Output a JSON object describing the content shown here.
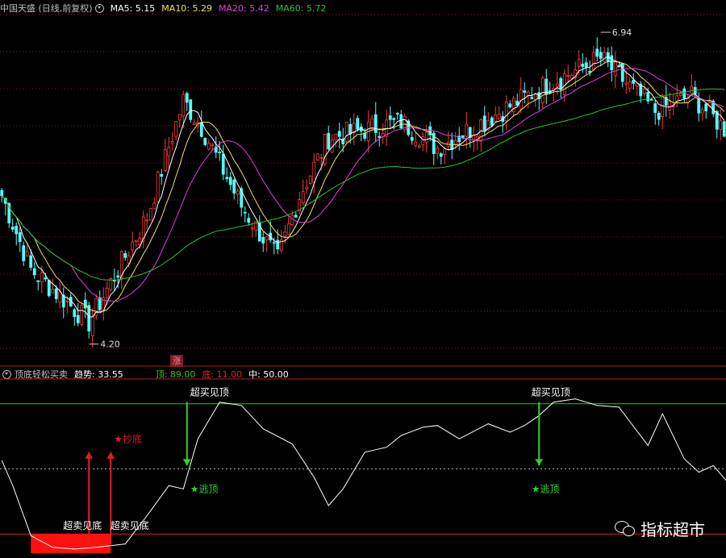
{
  "main_header": {
    "title": "中国天盛 (日线,前复权)",
    "ma5": "MA5: 5.15",
    "ma10": "MA10: 5.29",
    "ma20": "MA20: 5.42",
    "ma60": "MA60: 5.72"
  },
  "sub_header": {
    "title": "顶底轻松买卖",
    "trend": "趋势: 33.55",
    "top": "顶: 89.00",
    "bottom": "底: 11.00",
    "mid": "中: 50.00"
  },
  "badge": "涨",
  "watermark": "指标超市",
  "colors": {
    "up": "#ff3b3b",
    "down": "#54ffff",
    "ma5": "#ffffff",
    "ma10": "#f0e060",
    "ma20": "#e040e0",
    "ma60": "#30c030",
    "grid": "#8a1e1e",
    "top_line": "#30c030",
    "bottom_line": "#e02020",
    "mid_line": "#b0b0b0",
    "trend_line": "#ffffff"
  },
  "chart_data": [
    {
      "type": "candlestick",
      "title": "中国天盛 (日线,前复权)",
      "ylim": [
        3.9,
        7.2
      ],
      "annotations": [
        {
          "label": "4.20",
          "x": 24,
          "y": 4.2
        },
        {
          "label": "6.94",
          "x": 165,
          "y": 6.94
        }
      ],
      "key_points": {
        "x": [
          0,
          8,
          24,
          40,
          50,
          55,
          66,
          76,
          82,
          90,
          110,
          120,
          150,
          165,
          180,
          190,
          200
        ],
        "close": [
          5.5,
          4.8,
          4.3,
          5.3,
          6.4,
          6.15,
          5.4,
          4.9,
          5.5,
          6.05,
          6.2,
          5.95,
          6.55,
          6.8,
          6.3,
          6.45,
          6.1
        ]
      },
      "series": [
        {
          "name": "MA5",
          "value": 5.15
        },
        {
          "name": "MA10",
          "value": 5.29
        },
        {
          "name": "MA20",
          "value": 5.42
        },
        {
          "name": "MA60",
          "value": 5.72
        }
      ]
    },
    {
      "type": "line",
      "title": "顶底轻松买卖",
      "ylim": [
        0,
        100
      ],
      "levels": {
        "top": 89.0,
        "bottom": 11.0,
        "mid": 50.0
      },
      "trend_now": 33.55,
      "trend": {
        "x": [
          0,
          3,
          8,
          14,
          20,
          26,
          34,
          40,
          46,
          50,
          54,
          60,
          66,
          72,
          80,
          86,
          90,
          94,
          100,
          106,
          110,
          116,
          120,
          126,
          134,
          140,
          144,
          148,
          152,
          158,
          164,
          170,
          178,
          182,
          188,
          192,
          196,
          200
        ],
        "y": [
          55,
          40,
          10,
          3,
          2,
          3,
          5,
          22,
          40,
          38,
          68,
          90,
          88,
          74,
          65,
          45,
          28,
          38,
          60,
          63,
          70,
          75,
          76,
          68,
          77,
          72,
          76,
          82,
          90,
          92,
          88,
          87,
          64,
          83,
          56,
          48,
          52,
          42
        ]
      },
      "labels": [
        {
          "text": "超卖见底",
          "x": 20
        },
        {
          "text": "超卖见底",
          "x": 33
        },
        {
          "text": "★抄底",
          "x": 34
        },
        {
          "text": "超买见顶",
          "x": 55
        },
        {
          "text": "★逃顶",
          "x": 55
        },
        {
          "text": "超买见顶",
          "x": 149
        },
        {
          "text": "★逃顶",
          "x": 149
        }
      ],
      "signals": [
        {
          "type": "buy",
          "x": 24
        },
        {
          "type": "buy",
          "x": 30
        },
        {
          "type": "sell",
          "x": 51
        },
        {
          "type": "sell",
          "x": 148
        }
      ]
    }
  ]
}
